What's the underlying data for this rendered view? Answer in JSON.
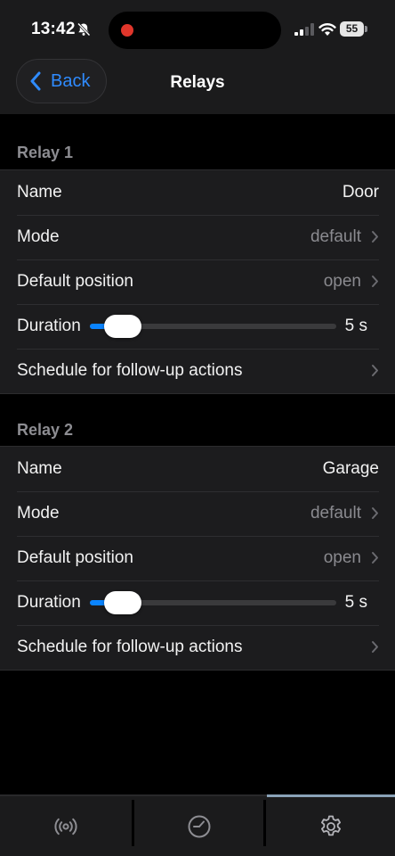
{
  "status_bar": {
    "time": "13:42",
    "battery": "55"
  },
  "nav": {
    "back_label": "Back",
    "title": "Relays"
  },
  "relays": [
    {
      "header": "Relay 1",
      "name_label": "Name",
      "name_value": "Door",
      "mode_label": "Mode",
      "mode_value": "default",
      "position_label": "Default position",
      "position_value": "open",
      "duration_label": "Duration",
      "duration_value": "5 s",
      "schedule_label": "Schedule for follow-up actions"
    },
    {
      "header": "Relay 2",
      "name_label": "Name",
      "name_value": "Garage",
      "mode_label": "Mode",
      "mode_value": "default",
      "position_label": "Default position",
      "position_value": "open",
      "duration_label": "Duration",
      "duration_value": "5 s",
      "schedule_label": "Schedule for follow-up actions"
    }
  ],
  "tabs": [
    {
      "icon": "broadcast-icon",
      "active": false
    },
    {
      "icon": "gauge-icon",
      "active": false
    },
    {
      "icon": "settings-gear-icon",
      "active": true
    }
  ],
  "colors": {
    "accent": "#0a84ff",
    "link": "#2f8bff",
    "recording": "#e0362b",
    "active_tab_indicator": "#8aa2b8"
  }
}
